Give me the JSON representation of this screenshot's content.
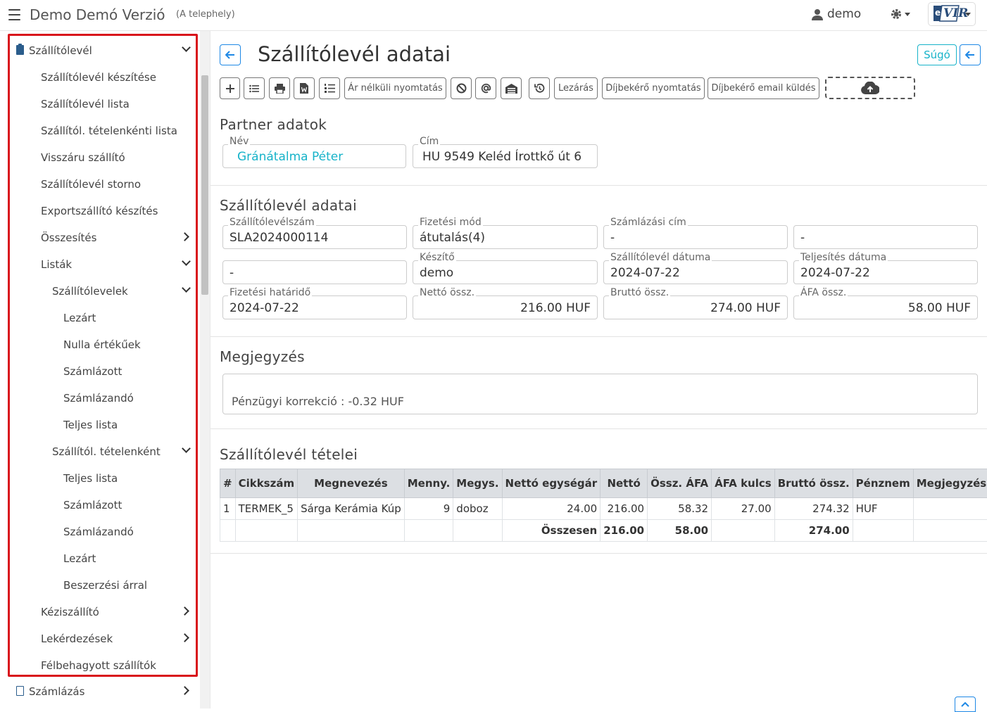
{
  "header": {
    "app_title": "Demo Demó Verzió",
    "location": "(A telephely)",
    "user": "demo",
    "logo_text": "VIR",
    "logo_letter": "e"
  },
  "sidebar": {
    "items": [
      {
        "label": "Szállítólevél",
        "level": 0,
        "chevron": "down",
        "icon": "clipboard-icon"
      },
      {
        "label": "Szállítólevél készítése",
        "level": 1
      },
      {
        "label": "Szállítólevél lista",
        "level": 1
      },
      {
        "label": "Szállítól. tételenkénti lista",
        "level": 1
      },
      {
        "label": "Visszáru szállító",
        "level": 1
      },
      {
        "label": "Szállítólevél storno",
        "level": 1
      },
      {
        "label": "Exportszállító készítés",
        "level": 1
      },
      {
        "label": "Összesítés",
        "level": 1,
        "chevron": "right"
      },
      {
        "label": "Listák",
        "level": 1,
        "chevron": "down"
      },
      {
        "label": "Szállítólevelek",
        "level": 2,
        "chevron": "down"
      },
      {
        "label": "Lezárt",
        "level": 3
      },
      {
        "label": "Nulla értékűek",
        "level": 3
      },
      {
        "label": "Számlázott",
        "level": 3
      },
      {
        "label": "Számlázandó",
        "level": 3
      },
      {
        "label": "Teljes lista",
        "level": 3
      },
      {
        "label": "Szállítól. tételenként",
        "level": 2,
        "chevron": "down"
      },
      {
        "label": "Teljes lista",
        "level": 3
      },
      {
        "label": "Számlázott",
        "level": 3
      },
      {
        "label": "Számlázandó",
        "level": 3
      },
      {
        "label": "Lezárt",
        "level": 3
      },
      {
        "label": "Beszerzési árral",
        "level": 3
      },
      {
        "label": "Kéziszállító",
        "level": 1,
        "chevron": "right"
      },
      {
        "label": "Lekérdezések",
        "level": 1,
        "chevron": "right"
      },
      {
        "label": "Félbehagyott szállítók",
        "level": 1
      },
      {
        "label": "Számlázás",
        "level": 0,
        "chevron": "right",
        "icon": "document-icon"
      }
    ]
  },
  "page": {
    "title": "Szállítólevél adatai",
    "help_label": "Súgó"
  },
  "toolbar": {
    "print_without_price": "Ár nélküli nyomtatás",
    "close": "Lezárás",
    "fee_print": "Díjbekérő nyomtatás",
    "fee_email": "Díjbekérő email küldés"
  },
  "partner": {
    "section_title": "Partner adatok",
    "name_label": "Név",
    "name": "Gránátalma Péter",
    "address_label": "Cím",
    "address": "HU 9549 Keléd Írottkő út 6"
  },
  "delivery": {
    "section_title": "Szállítólevél adatai",
    "number_label": "Szállítólevélszám",
    "number": "SLA2024000114",
    "payment_label": "Fizetési mód",
    "payment": "átutalás(4)",
    "billing_label": "Számlázási cím",
    "billing": "-",
    "extra1": "-",
    "extra2": "-",
    "creator_label": "Készítő",
    "creator": "demo",
    "date_label": "Szállítólevél dátuma",
    "date": "2024-07-22",
    "fulfil_label": "Teljesítés dátuma",
    "fulfil": "2024-07-22",
    "due_label": "Fizetési határidő",
    "due": "2024-07-22",
    "net_label": "Nettó össz.",
    "net": "216.00 HUF",
    "gross_label": "Bruttó össz.",
    "gross": "274.00 HUF",
    "vat_label": "ÁFA össz.",
    "vat": "58.00 HUF"
  },
  "note": {
    "section_title": "Megjegyzés",
    "text": "Pénzügyi korrekció : -0.32 HUF"
  },
  "items": {
    "section_title": "Szállítólevél tételei",
    "columns": [
      "#",
      "Cikkszám",
      "Megnevezés",
      "Menny.",
      "Megys.",
      "Nettó egységár",
      "Nettó",
      "Össz. ÁFA",
      "ÁFA kulcs",
      "Bruttó össz.",
      "Pénznem",
      "Megjegyzés"
    ],
    "rows": [
      [
        "1",
        "TERMEK_5",
        "Sárga Kerámia Kúp",
        "9",
        "doboz",
        "24.00",
        "216.00",
        "58.32",
        "27.00",
        "274.32",
        "HUF",
        ""
      ]
    ],
    "total_label": "Összesen",
    "total_net": "216.00",
    "total_vat": "58.00",
    "total_gross": "274.00"
  }
}
